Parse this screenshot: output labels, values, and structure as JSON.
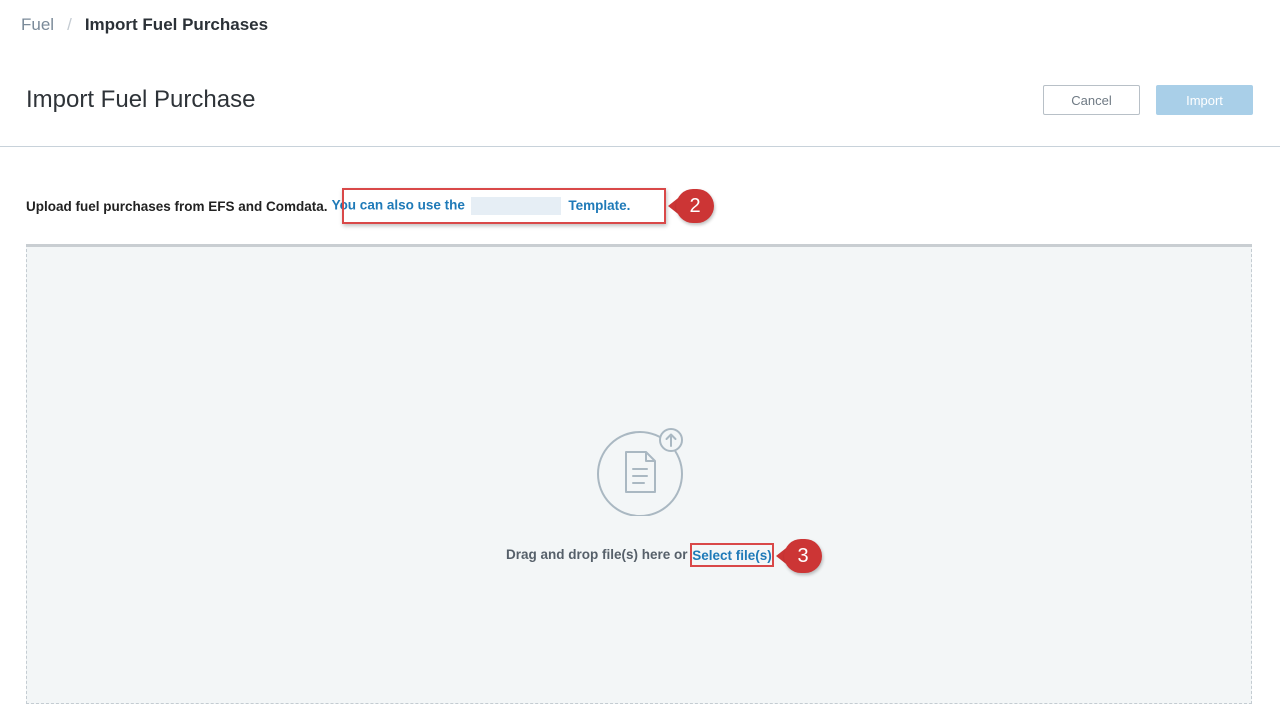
{
  "breadcrumb": {
    "parent": "Fuel",
    "separator": "/",
    "current": "Import Fuel Purchases"
  },
  "header": {
    "title": "Import Fuel Purchase",
    "cancel_label": "Cancel",
    "import_label": "Import"
  },
  "instructions": {
    "text": "Upload fuel purchases from EFS and Comdata.",
    "link_text": "You can also use the",
    "link_tail": "Template."
  },
  "dropzone": {
    "text": "Drag and drop file(s) here or",
    "select_label": "Select file(s)"
  },
  "callouts": {
    "step2": "2",
    "step3": "3"
  },
  "colors": {
    "link": "#1f7ab8",
    "annotation": "#cc3535",
    "import_button": "#a9cfe8"
  }
}
